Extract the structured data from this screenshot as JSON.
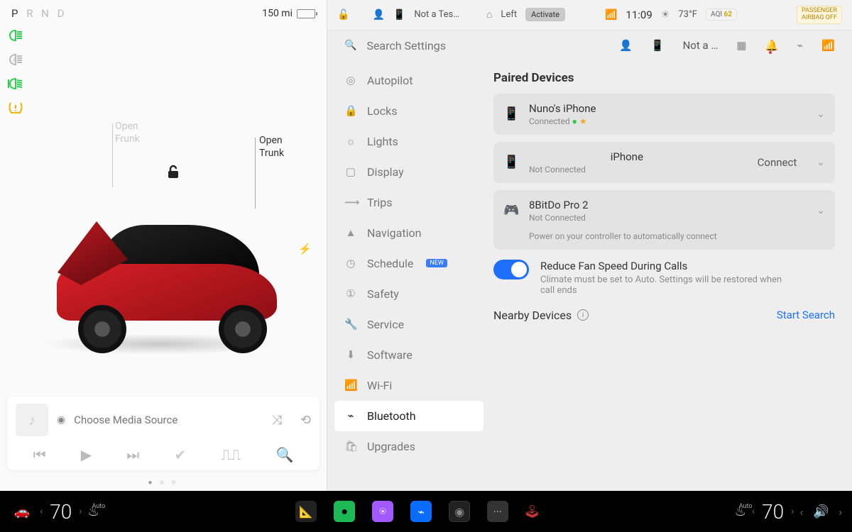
{
  "car": {
    "gear_letters": "P R N D",
    "gear_active": "P",
    "range": "150 mi",
    "frunk_label_1": "Open",
    "frunk_label_2": "Frunk",
    "trunk_label_1": "Open",
    "trunk_label_2": "Trunk"
  },
  "media": {
    "source": "Choose Media Source"
  },
  "status": {
    "profile": "Not a Tes…",
    "homelink": "Left",
    "activate": "Activate",
    "time": "11:09",
    "temp": "73°F",
    "aqi_label": "AQI",
    "aqi_value": "62",
    "airbag_l1": "PASSENGER",
    "airbag_l2": "AIRBAG OFF"
  },
  "search": {
    "placeholder": "Search Settings",
    "profile_short": "Not a …"
  },
  "nav": {
    "autopilot": "Autopilot",
    "locks": "Locks",
    "lights": "Lights",
    "display": "Display",
    "trips": "Trips",
    "navigation": "Navigation",
    "schedule": "Schedule",
    "schedule_badge": "NEW",
    "safety": "Safety",
    "service": "Service",
    "software": "Software",
    "wifi": "Wi-Fi",
    "bluetooth": "Bluetooth",
    "upgrades": "Upgrades"
  },
  "bt": {
    "paired_heading": "Paired Devices",
    "dev1_name": "Nuno's iPhone",
    "dev1_status": "Connected",
    "dev2_name": "iPhone",
    "dev2_status": "Not Connected",
    "dev2_action": "Connect",
    "dev3_name": "8BitDo Pro 2",
    "dev3_status": "Not Connected",
    "dev3_hint": "Power on your controller to automatically connect",
    "toggle_title": "Reduce Fan Speed During Calls",
    "toggle_desc": "Climate must be set to Auto. Settings will be restored when call ends",
    "nearby_heading": "Nearby Devices",
    "start_search": "Start Search"
  },
  "bottom": {
    "temp_left": "70",
    "temp_right": "70",
    "auto": "Auto"
  }
}
